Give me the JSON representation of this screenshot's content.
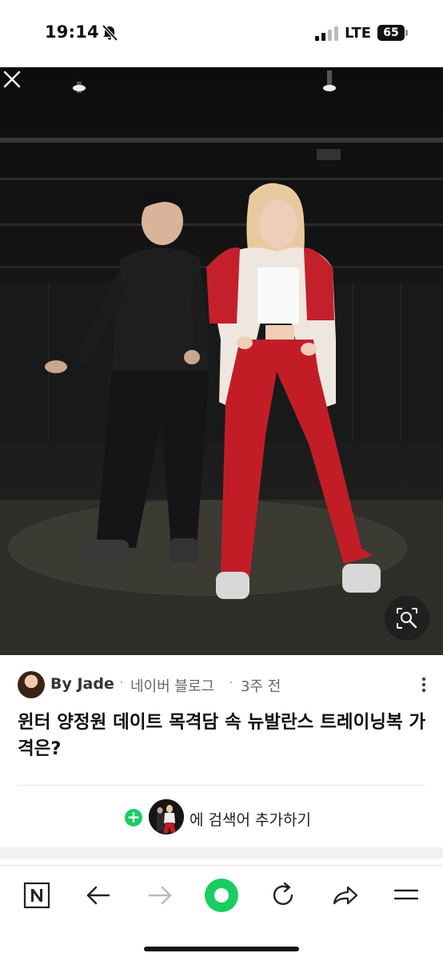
{
  "status": {
    "time": "19:14",
    "network": "LTE",
    "battery": "65"
  },
  "viewer": {
    "close_icon": "close-icon",
    "lens_icon": "image-search-icon"
  },
  "article": {
    "author": "By Jade",
    "separator": "·",
    "blog": "네이버 블로그",
    "time_ago": "3주 전",
    "title": "윈터 양정원 데이트 목격담 속 뉴발란스 트레이닝복 가격은?"
  },
  "add_search": {
    "label": "에 검색어 추가하기",
    "plus": "+"
  },
  "toolbar": {
    "items": [
      "naver-home-icon",
      "back-icon",
      "forward-icon",
      "green-dot-icon",
      "reload-icon",
      "share-icon",
      "menu-icon"
    ],
    "brand_color": "#19ce60"
  }
}
